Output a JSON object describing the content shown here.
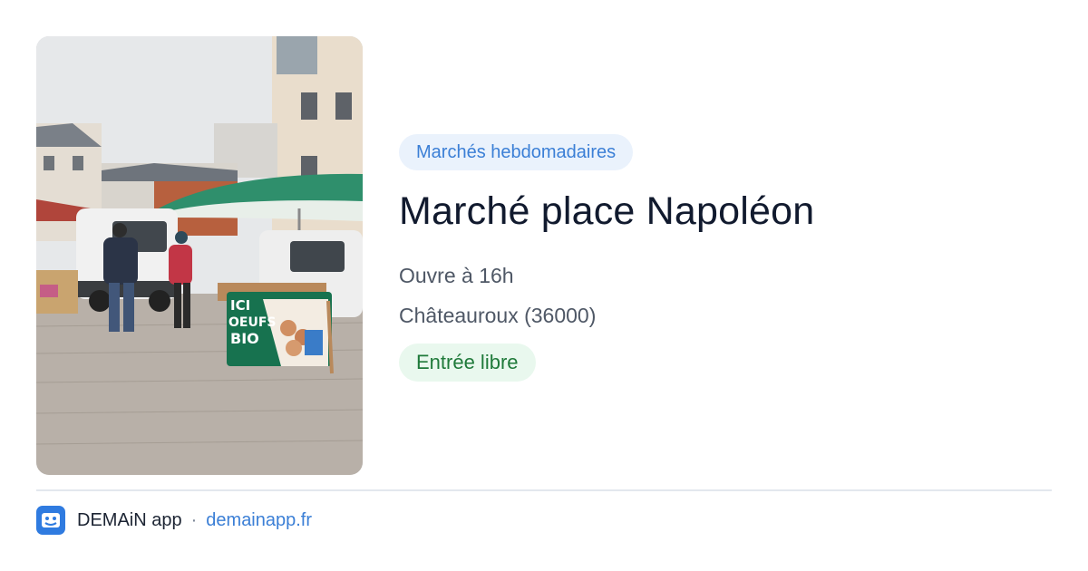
{
  "photo": {
    "sign_lines": [
      "ICI",
      "OEUFS",
      "BIO"
    ]
  },
  "event": {
    "category": "Marchés hebdomadaires",
    "title": "Marché place Napoléon",
    "hours": "Ouvre à 16h",
    "location": "Châteauroux (36000)",
    "access": "Entrée libre"
  },
  "footer": {
    "app_name": "DEMAiN app",
    "separator": "·",
    "url": "demainapp.fr"
  },
  "colors": {
    "category_badge_bg": "#eaf2fc",
    "category_badge_text": "#3b7fd6",
    "access_badge_bg": "#e9f8ee",
    "access_badge_text": "#1f7a3a",
    "title": "#111a2e",
    "brand_blue": "#2f7be0"
  }
}
